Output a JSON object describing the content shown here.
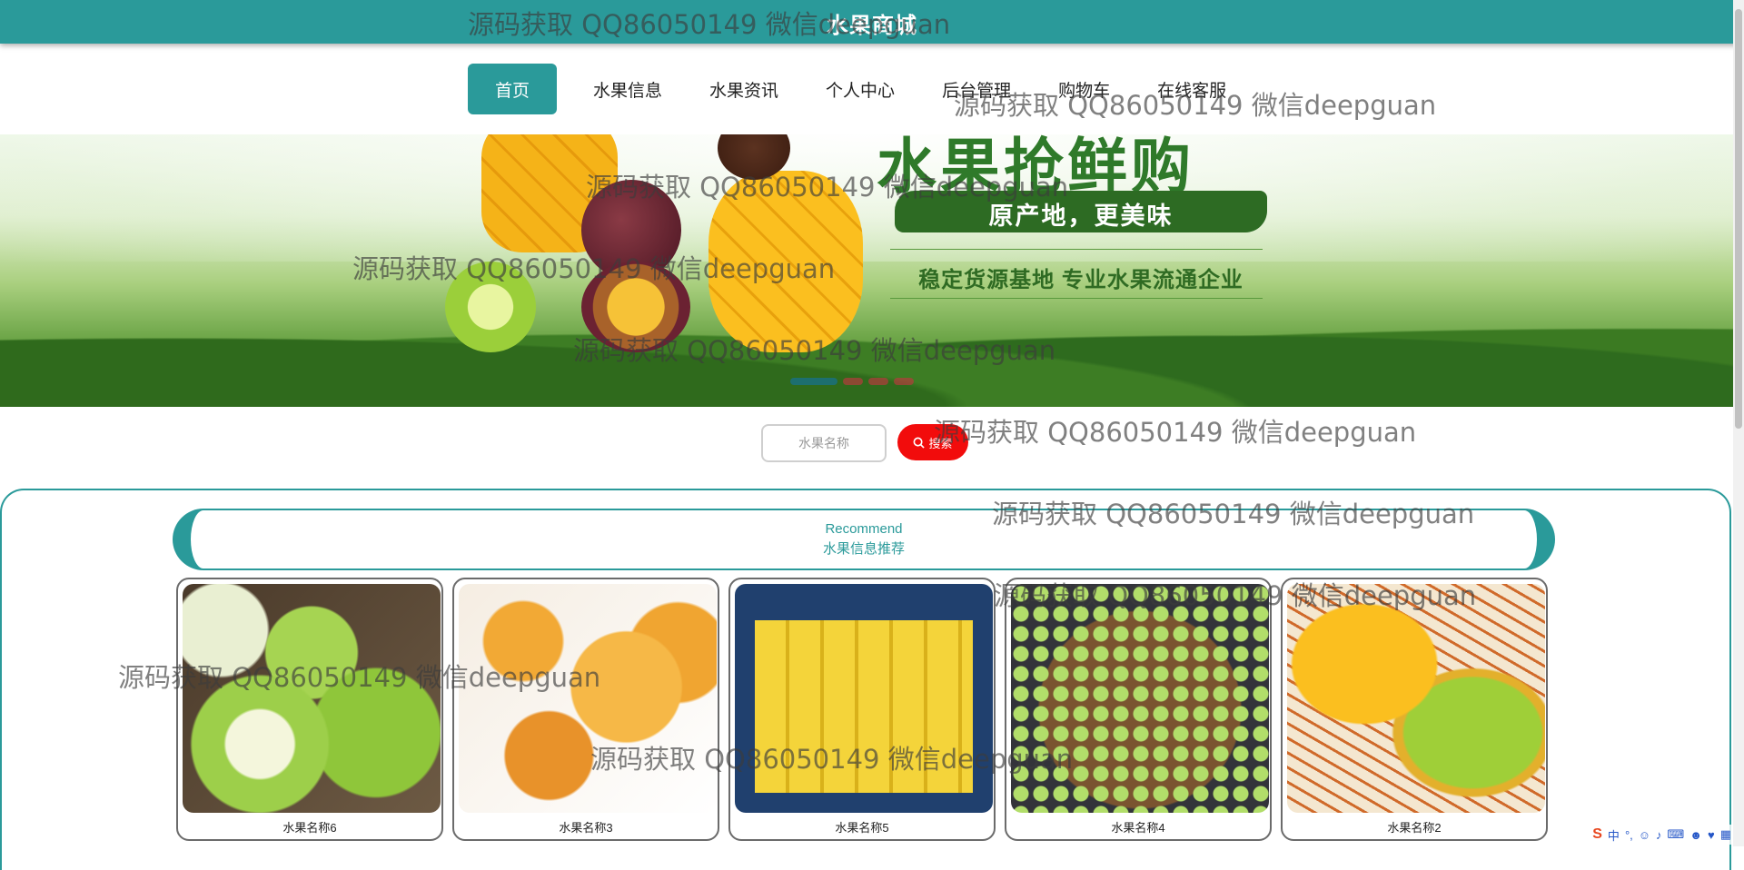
{
  "header": {
    "title": "水果商城"
  },
  "nav": {
    "items": [
      "首页",
      "水果信息",
      "水果资讯",
      "个人中心",
      "后台管理",
      "购物车",
      "在线客服"
    ]
  },
  "banner": {
    "headline": "水果抢鲜购",
    "sub": "原产地，更美味",
    "slogan": "稳定货源基地 专业水果流通企业"
  },
  "search": {
    "placeholder": "水果名称",
    "button_label": "搜索"
  },
  "recommend": {
    "title_en": "Recommend",
    "title_cn": "水果信息推荐"
  },
  "products": [
    {
      "name": "水果名称6",
      "fruit": "green-apple"
    },
    {
      "name": "水果名称3",
      "fruit": "loquat"
    },
    {
      "name": "水果名称5",
      "fruit": "banana"
    },
    {
      "name": "水果名称4",
      "fruit": "grape"
    },
    {
      "name": "水果名称2",
      "fruit": "mango"
    }
  ],
  "watermark": "源码获取 QQ86050149 微信deepguan",
  "ime": {
    "label": "中"
  },
  "colors": {
    "primary": "#2a9a9a",
    "search_button": "#f20c0c"
  }
}
